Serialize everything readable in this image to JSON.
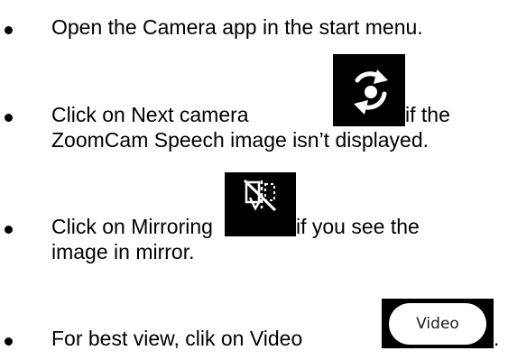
{
  "instructions": {
    "step1": {
      "text": "Open the Camera app  in the start menu."
    },
    "step2": {
      "text_before": "Click on Next camera",
      "text_after": " if the",
      "text_line2": "ZoomCam Speech image isn’t displayed.",
      "icon": "camera-switch-icon"
    },
    "step3": {
      "text_before": "Click on Mirroring",
      "text_after": " if you see the",
      "text_line2": "image in mirror.",
      "icon": "mirroring-icon"
    },
    "step4": {
      "text_before": "For best view, clik on Video",
      "text_after": ".",
      "button_label": "Video"
    }
  },
  "colors": {
    "text": "#000000",
    "icon_background": "#000000",
    "icon_foreground": "#ffffff"
  }
}
